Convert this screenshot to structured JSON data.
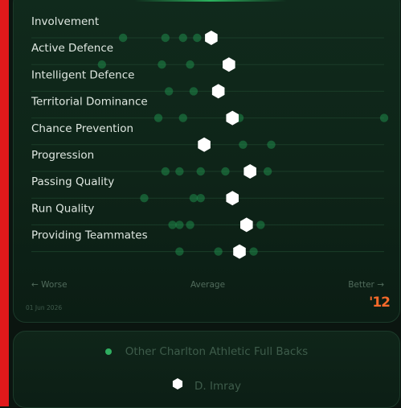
{
  "chart_data": {
    "type": "scatter",
    "xlim": [
      0,
      100
    ],
    "categories": [
      "Involvement",
      "Active Defence",
      "Intelligent Defence",
      "Territorial Dominance",
      "Chance Prevention",
      "Progression",
      "Passing Quality",
      "Run Quality",
      "Providing Teammates"
    ],
    "series": [
      {
        "name": "Other Charlton Athletic Full Backs",
        "color": "#1f8a4a",
        "values": [
          [
            26,
            38,
            43,
            47
          ],
          [
            20,
            37,
            45
          ],
          [
            39,
            46
          ],
          [
            36,
            43,
            59,
            100
          ],
          [
            60,
            68
          ],
          [
            38,
            42,
            48,
            55,
            67
          ],
          [
            32,
            46,
            48
          ],
          [
            40,
            42,
            45,
            65
          ],
          [
            42,
            53,
            63
          ]
        ]
      },
      {
        "name": "D. Imray",
        "color": "#ffffff",
        "values": [
          51,
          56,
          53,
          57,
          49,
          62,
          57,
          61,
          59
        ]
      }
    ],
    "x_axis_labels": {
      "left": "← Worse",
      "center": "Average",
      "right": "Better →"
    }
  },
  "footer": {
    "date": "01 Jun 2026",
    "brand": "'12"
  },
  "legend": {
    "others_label": "Other Charlton Athletic Full Backs",
    "player_label": "D. Imray"
  },
  "colors": {
    "accent_bar": "#e0191b",
    "brand": "#f4692a"
  }
}
